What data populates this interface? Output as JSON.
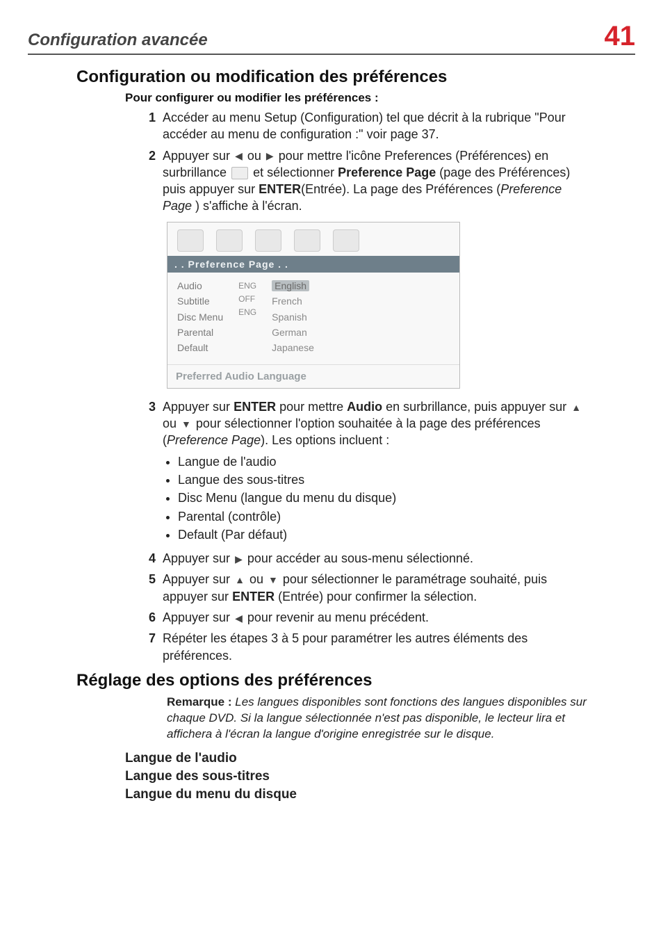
{
  "header": {
    "title": "Configuration avancée",
    "page_number": "41"
  },
  "section1": {
    "heading": "Configuration ou modification des préférences",
    "subheading": "Pour configurer ou modifier les préférences :",
    "steps": {
      "s1": {
        "num": "1",
        "text": "Accéder au menu Setup (Configuration) tel que décrit à la rubrique \"Pour accéder au menu de configuration :\" voir page 37."
      },
      "s2": {
        "num": "2",
        "p1a": "Appuyer sur ",
        "p1b": " ou ",
        "p1c": " pour mettre l'icône Preferences (Préférences) en surbrillance ",
        "p2a": " et sélectionner ",
        "bold1": "Preference Page",
        "p2b": " (page des Préférences) puis appuyer sur ",
        "bold2": "ENTER",
        "p3a": "(Entrée). La page des Préférences (",
        "ital1": "Preference Page ",
        "p3b": ") s'affiche à l'écran."
      },
      "s3": {
        "num": "3",
        "p1a": "Appuyer sur ",
        "bold1": "ENTER",
        "p1b": "  pour mettre ",
        "bold2": "Audio",
        "p1c": " en surbrillance, puis appuyer sur ",
        "p1d": " ou ",
        "p2a": "pour sélectionner l'option souhaitée à la page des préférences (",
        "ital1": "Preference Page",
        "p2b": "). Les options incluent :",
        "bullets": [
          "Langue de l'audio",
          "Langue des sous-titres",
          "Disc Menu (langue du menu du disque)",
          "Parental (contrôle)",
          "Default (Par défaut)"
        ]
      },
      "s4": {
        "num": "4",
        "p1a": "Appuyer sur ",
        "p1b": " pour accéder au sous-menu sélectionné."
      },
      "s5": {
        "num": "5",
        "p1a": "Appuyer sur ",
        "p1b": " ou ",
        "p1c": " pour sélectionner le paramétrage souhaité, puis appuyer sur ",
        "bold1": "ENTER",
        "p2a": " (Entrée) pour confirmer la sélection."
      },
      "s6": {
        "num": "6",
        "p1a": "Appuyer sur ",
        "p1b": " pour revenir au menu précédent."
      },
      "s7": {
        "num": "7",
        "text": "Répéter les étapes 3 à 5 pour paramétrer les autres éléments des préférences."
      }
    }
  },
  "screenshot": {
    "title": ". .   Preference Page . .",
    "labels": [
      "Audio",
      "Subtitle",
      "Disc  Menu",
      "Parental",
      "Default"
    ],
    "codes": [
      "ENG",
      "Off",
      "ENG",
      "",
      ""
    ],
    "values": [
      "English",
      "French",
      "Spanish",
      "German",
      "Japanese"
    ],
    "footer": "Preferred Audio Language"
  },
  "section2": {
    "heading": "Réglage des options des préférences",
    "note_label": "Remarque :",
    "note_body": " Les langues disponibles sont fonctions des langues disponibles sur chaque DVD. Si la langue sélectionnée n'est pas disponible, le lecteur lira et affichera à l'écran la langue d'origine enregistrée sur le disque.",
    "items": [
      "Langue de l'audio",
      "Langue des sous-titres",
      "Langue du menu du disque"
    ]
  },
  "glyphs": {
    "left": "◀",
    "right": "▶",
    "up": "▲",
    "down": "▼"
  }
}
